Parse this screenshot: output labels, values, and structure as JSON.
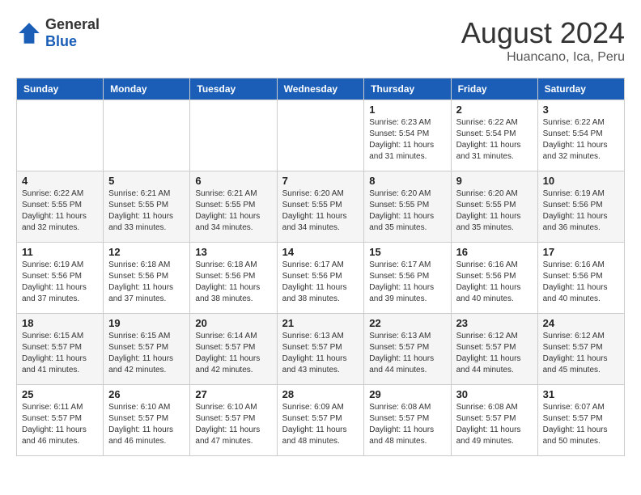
{
  "header": {
    "logo_general": "General",
    "logo_blue": "Blue",
    "title": "August 2024",
    "subtitle": "Huancano, Ica, Peru"
  },
  "weekdays": [
    "Sunday",
    "Monday",
    "Tuesday",
    "Wednesday",
    "Thursday",
    "Friday",
    "Saturday"
  ],
  "weeks": [
    [
      {
        "day": "",
        "sunrise": "",
        "sunset": "",
        "daylight": ""
      },
      {
        "day": "",
        "sunrise": "",
        "sunset": "",
        "daylight": ""
      },
      {
        "day": "",
        "sunrise": "",
        "sunset": "",
        "daylight": ""
      },
      {
        "day": "",
        "sunrise": "",
        "sunset": "",
        "daylight": ""
      },
      {
        "day": "1",
        "sunrise": "Sunrise: 6:23 AM",
        "sunset": "Sunset: 5:54 PM",
        "daylight": "Daylight: 11 hours and 31 minutes."
      },
      {
        "day": "2",
        "sunrise": "Sunrise: 6:22 AM",
        "sunset": "Sunset: 5:54 PM",
        "daylight": "Daylight: 11 hours and 31 minutes."
      },
      {
        "day": "3",
        "sunrise": "Sunrise: 6:22 AM",
        "sunset": "Sunset: 5:54 PM",
        "daylight": "Daylight: 11 hours and 32 minutes."
      }
    ],
    [
      {
        "day": "4",
        "sunrise": "Sunrise: 6:22 AM",
        "sunset": "Sunset: 5:55 PM",
        "daylight": "Daylight: 11 hours and 32 minutes."
      },
      {
        "day": "5",
        "sunrise": "Sunrise: 6:21 AM",
        "sunset": "Sunset: 5:55 PM",
        "daylight": "Daylight: 11 hours and 33 minutes."
      },
      {
        "day": "6",
        "sunrise": "Sunrise: 6:21 AM",
        "sunset": "Sunset: 5:55 PM",
        "daylight": "Daylight: 11 hours and 34 minutes."
      },
      {
        "day": "7",
        "sunrise": "Sunrise: 6:20 AM",
        "sunset": "Sunset: 5:55 PM",
        "daylight": "Daylight: 11 hours and 34 minutes."
      },
      {
        "day": "8",
        "sunrise": "Sunrise: 6:20 AM",
        "sunset": "Sunset: 5:55 PM",
        "daylight": "Daylight: 11 hours and 35 minutes."
      },
      {
        "day": "9",
        "sunrise": "Sunrise: 6:20 AM",
        "sunset": "Sunset: 5:55 PM",
        "daylight": "Daylight: 11 hours and 35 minutes."
      },
      {
        "day": "10",
        "sunrise": "Sunrise: 6:19 AM",
        "sunset": "Sunset: 5:56 PM",
        "daylight": "Daylight: 11 hours and 36 minutes."
      }
    ],
    [
      {
        "day": "11",
        "sunrise": "Sunrise: 6:19 AM",
        "sunset": "Sunset: 5:56 PM",
        "daylight": "Daylight: 11 hours and 37 minutes."
      },
      {
        "day": "12",
        "sunrise": "Sunrise: 6:18 AM",
        "sunset": "Sunset: 5:56 PM",
        "daylight": "Daylight: 11 hours and 37 minutes."
      },
      {
        "day": "13",
        "sunrise": "Sunrise: 6:18 AM",
        "sunset": "Sunset: 5:56 PM",
        "daylight": "Daylight: 11 hours and 38 minutes."
      },
      {
        "day": "14",
        "sunrise": "Sunrise: 6:17 AM",
        "sunset": "Sunset: 5:56 PM",
        "daylight": "Daylight: 11 hours and 38 minutes."
      },
      {
        "day": "15",
        "sunrise": "Sunrise: 6:17 AM",
        "sunset": "Sunset: 5:56 PM",
        "daylight": "Daylight: 11 hours and 39 minutes."
      },
      {
        "day": "16",
        "sunrise": "Sunrise: 6:16 AM",
        "sunset": "Sunset: 5:56 PM",
        "daylight": "Daylight: 11 hours and 40 minutes."
      },
      {
        "day": "17",
        "sunrise": "Sunrise: 6:16 AM",
        "sunset": "Sunset: 5:56 PM",
        "daylight": "Daylight: 11 hours and 40 minutes."
      }
    ],
    [
      {
        "day": "18",
        "sunrise": "Sunrise: 6:15 AM",
        "sunset": "Sunset: 5:57 PM",
        "daylight": "Daylight: 11 hours and 41 minutes."
      },
      {
        "day": "19",
        "sunrise": "Sunrise: 6:15 AM",
        "sunset": "Sunset: 5:57 PM",
        "daylight": "Daylight: 11 hours and 42 minutes."
      },
      {
        "day": "20",
        "sunrise": "Sunrise: 6:14 AM",
        "sunset": "Sunset: 5:57 PM",
        "daylight": "Daylight: 11 hours and 42 minutes."
      },
      {
        "day": "21",
        "sunrise": "Sunrise: 6:13 AM",
        "sunset": "Sunset: 5:57 PM",
        "daylight": "Daylight: 11 hours and 43 minutes."
      },
      {
        "day": "22",
        "sunrise": "Sunrise: 6:13 AM",
        "sunset": "Sunset: 5:57 PM",
        "daylight": "Daylight: 11 hours and 44 minutes."
      },
      {
        "day": "23",
        "sunrise": "Sunrise: 6:12 AM",
        "sunset": "Sunset: 5:57 PM",
        "daylight": "Daylight: 11 hours and 44 minutes."
      },
      {
        "day": "24",
        "sunrise": "Sunrise: 6:12 AM",
        "sunset": "Sunset: 5:57 PM",
        "daylight": "Daylight: 11 hours and 45 minutes."
      }
    ],
    [
      {
        "day": "25",
        "sunrise": "Sunrise: 6:11 AM",
        "sunset": "Sunset: 5:57 PM",
        "daylight": "Daylight: 11 hours and 46 minutes."
      },
      {
        "day": "26",
        "sunrise": "Sunrise: 6:10 AM",
        "sunset": "Sunset: 5:57 PM",
        "daylight": "Daylight: 11 hours and 46 minutes."
      },
      {
        "day": "27",
        "sunrise": "Sunrise: 6:10 AM",
        "sunset": "Sunset: 5:57 PM",
        "daylight": "Daylight: 11 hours and 47 minutes."
      },
      {
        "day": "28",
        "sunrise": "Sunrise: 6:09 AM",
        "sunset": "Sunset: 5:57 PM",
        "daylight": "Daylight: 11 hours and 48 minutes."
      },
      {
        "day": "29",
        "sunrise": "Sunrise: 6:08 AM",
        "sunset": "Sunset: 5:57 PM",
        "daylight": "Daylight: 11 hours and 48 minutes."
      },
      {
        "day": "30",
        "sunrise": "Sunrise: 6:08 AM",
        "sunset": "Sunset: 5:57 PM",
        "daylight": "Daylight: 11 hours and 49 minutes."
      },
      {
        "day": "31",
        "sunrise": "Sunrise: 6:07 AM",
        "sunset": "Sunset: 5:57 PM",
        "daylight": "Daylight: 11 hours and 50 minutes."
      }
    ]
  ]
}
